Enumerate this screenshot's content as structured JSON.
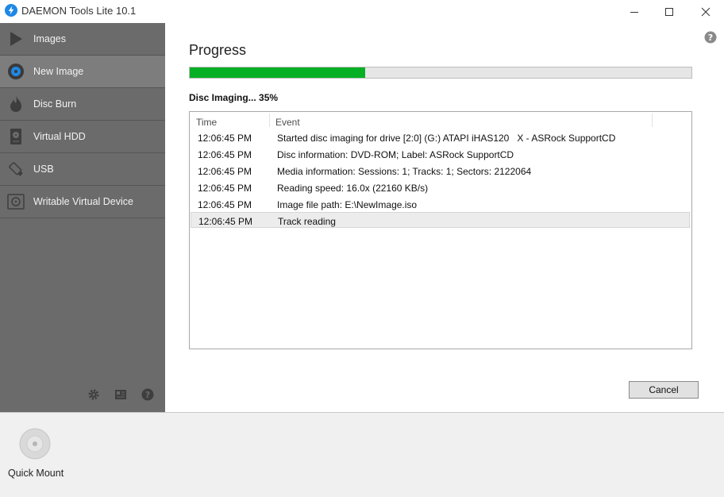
{
  "window": {
    "title": "DAEMON Tools Lite 10.1",
    "icon": "lightning-logo-icon",
    "accent_color": "#1e88e5"
  },
  "sidebar": {
    "background": "#6b6b6b",
    "items": [
      {
        "label": "Images",
        "icon": "play-triangle-icon"
      },
      {
        "label": "New Image",
        "icon": "disc-icon",
        "active": true
      },
      {
        "label": "Disc Burn",
        "icon": "flame-icon"
      },
      {
        "label": "Virtual HDD",
        "icon": "hard-drive-icon"
      },
      {
        "label": "USB",
        "icon": "usb-stick-icon"
      },
      {
        "label": "Writable Virtual Device",
        "icon": "writable-drive-icon"
      }
    ],
    "tools": [
      "gear-icon",
      "catalog-icon",
      "help-icon"
    ]
  },
  "main": {
    "title": "Progress",
    "progress": {
      "percent": 35,
      "fill_color": "#06b025"
    },
    "status": "Disc Imaging... 35%",
    "table": {
      "columns": [
        "Time",
        "Event"
      ],
      "rows": [
        {
          "time": "12:06:45 PM",
          "event": "Started disc imaging for drive [2:0] (G:) ATAPI iHAS120   X - ASRock SupportCD"
        },
        {
          "time": "12:06:45 PM",
          "event": "Disc information: DVD-ROM; Label: ASRock SupportCD"
        },
        {
          "time": "12:06:45 PM",
          "event": "Media information: Sessions: 1; Tracks: 1; Sectors: 2122064"
        },
        {
          "time": "12:06:45 PM",
          "event": "Reading speed: 16.0x (22160 KB/s)"
        },
        {
          "time": "12:06:45 PM",
          "event": "Image file path: E:\\NewImage.iso"
        },
        {
          "time": "12:06:45 PM",
          "event": "Track reading",
          "selected": true
        }
      ]
    },
    "cancel_label": "Cancel"
  },
  "bottom": {
    "quick_mount_label": "Quick Mount"
  }
}
